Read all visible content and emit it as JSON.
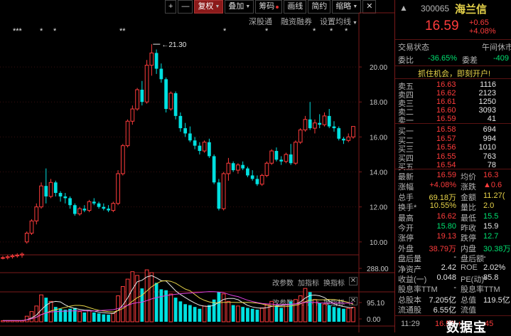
{
  "toolbar": {
    "plus": "+",
    "minus": "—",
    "fuquan": "复权",
    "diejia": "叠加",
    "chouma": "筹码",
    "huaxian": "画线",
    "jianyue": "简约",
    "shouqi": "缩略",
    "close": "✕"
  },
  "subbar": {
    "shengutong": "深股通",
    "rongzirongquan": "融资融券",
    "shezhi": "设置均线"
  },
  "chart_data": {
    "type": "candlestick",
    "price_ylim": [
      10.4,
      22.2
    ],
    "price_ticks": [
      "20.00",
      "18.00",
      "16.00",
      "14.00",
      "12.00",
      "10.00"
    ],
    "price_tick_values": [
      20,
      18,
      16,
      14,
      12,
      10
    ],
    "max_label": "21.30",
    "max_value": 21.3,
    "candles": [
      [
        9.1,
        9.2,
        9.0,
        9.1
      ],
      [
        9.1,
        9.25,
        9.0,
        9.15
      ],
      [
        9.15,
        9.3,
        9.05,
        9.2
      ],
      [
        9.2,
        9.35,
        9.1,
        9.25
      ],
      [
        9.25,
        9.4,
        9.1,
        9.3
      ],
      [
        10.0,
        10.6,
        9.9,
        10.5
      ],
      [
        10.5,
        11.3,
        10.4,
        11.2
      ],
      [
        11.2,
        12.2,
        11.0,
        12.0
      ],
      [
        12.0,
        13.4,
        11.9,
        13.2
      ],
      [
        13.2,
        14.2,
        12.2,
        12.6
      ],
      [
        12.6,
        13.6,
        12.5,
        13.4
      ],
      [
        13.4,
        13.5,
        12.6,
        12.8
      ],
      [
        12.8,
        12.9,
        12.3,
        12.6
      ],
      [
        12.6,
        12.8,
        12.2,
        12.5
      ],
      [
        12.5,
        12.6,
        11.9,
        12.1
      ],
      [
        12.1,
        12.2,
        11.5,
        11.6
      ],
      [
        11.6,
        12.0,
        11.5,
        11.9
      ],
      [
        11.9,
        12.1,
        11.7,
        11.8
      ],
      [
        11.8,
        12.4,
        11.7,
        12.3
      ],
      [
        12.3,
        12.5,
        12.1,
        12.2
      ],
      [
        12.2,
        12.3,
        11.9,
        12.0
      ],
      [
        12.0,
        12.2,
        11.8,
        11.9
      ],
      [
        11.9,
        12.1,
        11.7,
        11.8
      ],
      [
        11.8,
        12.3,
        11.7,
        12.2
      ],
      [
        12.2,
        14.1,
        12.1,
        13.9
      ],
      [
        13.9,
        15.6,
        13.8,
        15.5
      ],
      [
        15.5,
        17.0,
        15.4,
        16.9
      ],
      [
        16.9,
        17.8,
        16.7,
        17.6
      ],
      [
        17.6,
        18.8,
        17.5,
        18.7
      ],
      [
        18.7,
        19.2,
        17.8,
        18.0
      ],
      [
        18.0,
        20.4,
        17.9,
        20.1
      ],
      [
        20.1,
        21.3,
        19.5,
        20.8
      ],
      [
        20.8,
        21.0,
        19.6,
        19.9
      ],
      [
        19.9,
        20.2,
        19.1,
        19.3
      ],
      [
        19.3,
        19.4,
        17.4,
        17.6
      ],
      [
        17.6,
        18.6,
        17.5,
        18.5
      ],
      [
        18.5,
        18.6,
        17.0,
        17.2
      ],
      [
        17.2,
        17.4,
        16.3,
        16.5
      ],
      [
        16.5,
        16.8,
        16.0,
        16.2
      ],
      [
        16.2,
        16.6,
        15.7,
        15.8
      ],
      [
        15.8,
        16.0,
        15.3,
        15.5
      ],
      [
        15.5,
        15.7,
        15.0,
        15.2
      ],
      [
        15.2,
        15.8,
        15.1,
        15.7
      ],
      [
        15.7,
        15.9,
        14.8,
        14.9
      ],
      [
        14.9,
        15.0,
        13.3,
        13.4
      ],
      [
        13.4,
        13.6,
        11.8,
        11.9
      ],
      [
        11.9,
        14.0,
        11.8,
        13.9
      ],
      [
        13.9,
        14.8,
        13.5,
        14.5
      ],
      [
        14.5,
        14.6,
        14.0,
        14.1
      ],
      [
        14.1,
        14.5,
        13.9,
        14.4
      ],
      [
        14.4,
        14.6,
        14.1,
        14.2
      ],
      [
        14.2,
        14.3,
        13.7,
        13.8
      ],
      [
        13.8,
        14.1,
        13.5,
        13.6
      ],
      [
        13.6,
        13.8,
        13.2,
        13.3
      ],
      [
        13.3,
        13.9,
        13.2,
        13.8
      ],
      [
        13.8,
        14.6,
        13.7,
        14.5
      ],
      [
        14.5,
        15.3,
        14.4,
        15.2
      ],
      [
        15.2,
        15.4,
        14.6,
        14.7
      ],
      [
        14.7,
        14.9,
        14.4,
        14.6
      ],
      [
        14.6,
        15.1,
        14.5,
        15.0
      ],
      [
        15.0,
        15.6,
        14.4,
        14.5
      ],
      [
        14.5,
        15.8,
        14.4,
        15.7
      ],
      [
        15.7,
        16.5,
        15.6,
        16.4
      ],
      [
        16.4,
        17.2,
        16.3,
        17.0
      ],
      [
        17.0,
        18.0,
        16.4,
        16.5
      ],
      [
        16.5,
        17.0,
        16.2,
        16.8
      ],
      [
        16.8,
        17.3,
        16.5,
        16.7
      ],
      [
        16.7,
        17.4,
        16.6,
        17.2
      ],
      [
        17.2,
        17.6,
        16.5,
        16.6
      ],
      [
        16.6,
        16.9,
        16.3,
        16.5
      ],
      [
        16.5,
        16.6,
        15.8,
        15.9
      ],
      [
        15.9,
        16.0,
        15.6,
        15.8
      ],
      [
        15.8,
        16.2,
        15.7,
        16.0
      ],
      [
        16.0,
        16.6,
        15.9,
        16.6
      ]
    ],
    "vol_ylim": [
      0,
      288
    ],
    "vol_ticks": [
      "288.00",
      "95.10",
      "0.00"
    ],
    "vol_tick_values": [
      288,
      95.1,
      0
    ],
    "volumes": [
      6,
      6,
      6,
      6,
      6,
      30,
      55,
      85,
      145,
      130,
      110,
      80,
      70,
      65,
      70,
      75,
      55,
      50,
      60,
      50,
      45,
      40,
      38,
      45,
      140,
      190,
      230,
      270,
      250,
      180,
      280,
      265,
      210,
      175,
      170,
      150,
      130,
      110,
      95,
      90,
      80,
      70,
      85,
      90,
      120,
      160,
      150,
      110,
      90,
      85,
      80,
      75,
      70,
      65,
      75,
      95,
      110,
      85,
      75,
      90,
      110,
      120,
      140,
      180,
      160,
      120,
      100,
      95,
      90,
      80,
      75,
      70,
      72,
      78
    ],
    "indicator_labels": [
      "改参数",
      "加指标",
      "换指标"
    ],
    "star_markers_labels": [
      "***",
      "*",
      "*",
      "**",
      "*",
      "*",
      "*",
      "*",
      "*"
    ],
    "colors": {
      "up": "#ff3c3c",
      "down": "#00e0e0",
      "ma1": "#e8e8e8",
      "ma2": "#e8d44a",
      "ma3": "#e040e0"
    }
  },
  "quote": {
    "code": "300065",
    "name": "海兰信",
    "price": "16.59",
    "change": "+0.65",
    "change_pct": "+4.08%",
    "status_label": "交易状态",
    "status_value": "午间休市",
    "weibi_label": "委比",
    "weibi_value": "-36.65%",
    "weicha_label": "委差",
    "weicha_value": "-409",
    "promo": "抓住机会，即刻开户!",
    "asks": [
      {
        "label": "卖五",
        "price": "16.63",
        "vol": "1116"
      },
      {
        "label": "卖四",
        "price": "16.62",
        "vol": "2123"
      },
      {
        "label": "卖三",
        "price": "16.61",
        "vol": "1250"
      },
      {
        "label": "卖二",
        "price": "16.60",
        "vol": "3093"
      },
      {
        "label": "卖一",
        "price": "16.59",
        "vol": "41"
      }
    ],
    "bids": [
      {
        "label": "买一",
        "price": "16.58",
        "vol": "694"
      },
      {
        "label": "买二",
        "price": "16.57",
        "vol": "994"
      },
      {
        "label": "买三",
        "price": "16.56",
        "vol": "1010"
      },
      {
        "label": "买四",
        "price": "16.55",
        "vol": "763"
      },
      {
        "label": "买五",
        "price": "16.54",
        "vol": "78"
      }
    ],
    "stats": [
      {
        "l1": "最新",
        "v1": "16.59",
        "c1": "red",
        "l2": "均价",
        "v2": "16.3",
        "c2": "red"
      },
      {
        "l1": "涨幅",
        "v1": "+4.08%",
        "c1": "red",
        "l2": "涨跌",
        "v2": "▲0.6",
        "c2": "red"
      },
      {
        "l1": "总手",
        "v1": "69.18万",
        "c1": "yellow",
        "l2": "金额",
        "v2": "11.27(",
        "c2": "yellow"
      },
      {
        "l1": "换手*",
        "v1": "10.55%",
        "c1": "yellow",
        "l2": "量比",
        "v2": "2.0",
        "c2": "yellow"
      },
      {
        "l1": "最高",
        "v1": "16.62",
        "c1": "red",
        "l2": "最低",
        "v2": "15.5",
        "c2": "green"
      },
      {
        "l1": "今开",
        "v1": "15.80",
        "c1": "green",
        "l2": "昨收",
        "v2": "15.9",
        "c2": "white"
      },
      {
        "l1": "涨停",
        "v1": "19.13",
        "c1": "red",
        "l2": "跌停",
        "v2": "12.7",
        "c2": "green"
      },
      {
        "l1": "外盘",
        "v1": "38.79万",
        "c1": "red",
        "l2": "内盘",
        "v2": "30.38万",
        "c2": "green"
      },
      {
        "l1": "盘后量",
        "v1": "-",
        "c1": "white",
        "l2": "盘后额",
        "v2": "-",
        "c2": "white"
      },
      {
        "l1": "净资产",
        "v1": "2.42",
        "c1": "white",
        "l2": "ROE",
        "v2": "2.02%",
        "c2": "white"
      },
      {
        "l1": "收益(一)",
        "v1": "0.048",
        "c1": "white",
        "l2": "PE(动)*",
        "v2": "85.8",
        "c2": "white"
      },
      {
        "l1": "股息率TTM",
        "v1": "-",
        "c1": "white",
        "l2": "股息率TTM",
        "v2": "",
        "c2": "white"
      },
      {
        "l1": "总股本",
        "v1": "7.205亿",
        "c1": "white",
        "l2": "总值",
        "v2": "119.5亿",
        "c2": "white"
      },
      {
        "l1": "流通股",
        "v1": "6.55亿",
        "c1": "white",
        "l2": "流值",
        "v2": "",
        "c2": "white"
      }
    ],
    "tick_time": "11:29",
    "tick_price": "16.59",
    "tick_arrow": "↑",
    "tick_vol": "45",
    "watermark": "数据宝"
  }
}
